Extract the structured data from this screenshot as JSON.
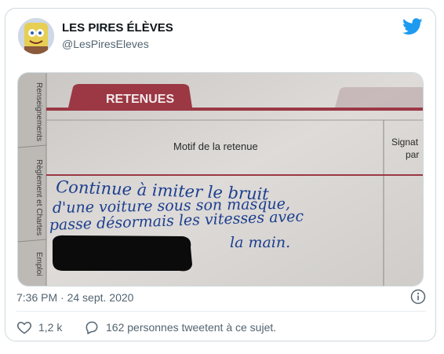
{
  "tweet": {
    "author_name": "LES PIRES ÉLÈVES",
    "author_handle": "@LesPiresEleves",
    "timestamp": "7:36 PM · 24 sept. 2020",
    "likes": "1,2 k",
    "replies_text": "162 personnes tweetent à ce sujet."
  },
  "photo": {
    "tab_label": "RETENUES",
    "column_header": "Motif de la retenue",
    "column_header_right": "Signat",
    "column_header_right2": "par",
    "side_tabs": [
      "Renseignements",
      "Règlement et Chartes",
      "Emploi"
    ],
    "handwriting_lines": [
      "Continue à imiter le bruit",
      "d'une voiture sous son masque,",
      "passe désormais les vitesses avec",
      "la main."
    ]
  },
  "icons": {
    "bird": "twitter-bird-icon",
    "info": "info-icon",
    "like": "heart-icon",
    "reply": "speech-bubble-icon"
  },
  "colors": {
    "twitter_blue": "#1d9bf0",
    "muted_text": "#536471",
    "tab_red": "#9b3844",
    "ink_blue": "#1d3f8f"
  }
}
